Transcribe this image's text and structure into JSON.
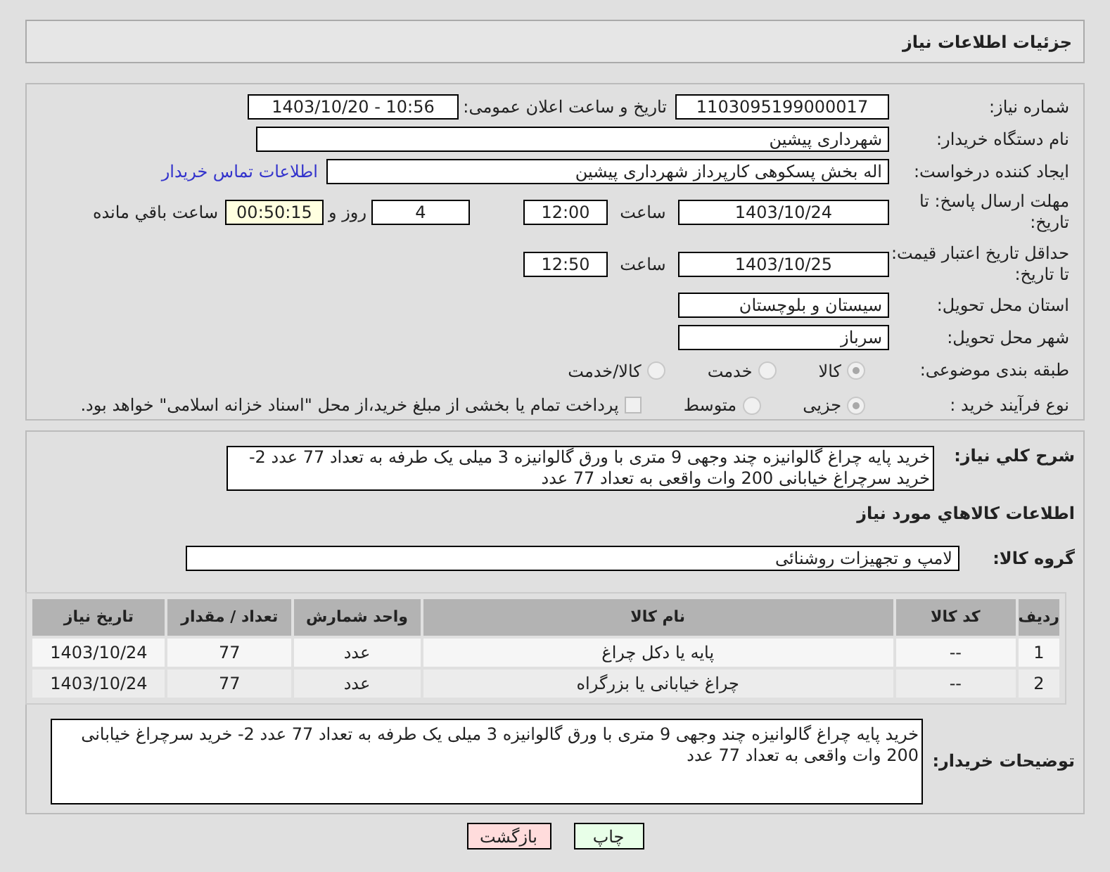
{
  "header": {
    "title": "جزئیات اطلاعات نیاز"
  },
  "details": {
    "need_number": {
      "label": "شماره نیاز:",
      "value": "1103095199000017"
    },
    "announcement": {
      "label": "تاریخ و ساعت اعلان عمومی:",
      "value": "1403/10/20 - 10:56"
    },
    "buyer_name": {
      "label": "نام دستگاه خریدار:",
      "value": "شهرداری پیشین"
    },
    "requester": {
      "label": "ایجاد کننده درخواست:",
      "value": "اله بخش پسکوهی کارپرداز شهرداری پیشین",
      "link": "اطلاعات تماس خریدار"
    },
    "deadline": {
      "label": "مهلت ارسال پاسخ: تا تاریخ:",
      "date": "1403/10/24",
      "time_label": "ساعت",
      "time": "12:00",
      "days": "4",
      "days_label": "روز و",
      "remaining": "00:50:15",
      "remaining_label": "ساعت باقي مانده"
    },
    "price_validity": {
      "label": "حداقل تاریخ اعتبار قیمت: تا تاریخ:",
      "date": "1403/10/25",
      "time_label": "ساعت",
      "time": "12:50"
    },
    "province": {
      "label": "استان محل تحویل:",
      "value": "سیستان و بلوچستان"
    },
    "city": {
      "label": "شهر محل تحویل:",
      "value": "سرباز"
    },
    "category": {
      "label": "طبقه بندی موضوعی:",
      "options": [
        {
          "label": "کالا",
          "selected": true
        },
        {
          "label": "خدمت",
          "selected": false
        },
        {
          "label": "کالا/خدمت",
          "selected": false
        }
      ]
    },
    "purchase_type": {
      "label": "نوع فرآیند خرید :",
      "options": [
        {
          "label": "جزیی",
          "selected": true
        },
        {
          "label": "متوسط",
          "selected": false
        }
      ],
      "payment": {
        "label": "پرداخت تمام یا بخشی از مبلغ خرید،از محل \"اسناد خزانه اسلامی\" خواهد بود.",
        "checked": false
      }
    }
  },
  "need_description": {
    "label": "شرح کلي نیاز:",
    "value": "خرید پایه چراغ گالوانیزه چند وجهی 9 متری با ورق گالوانیزه 3 میلی یک طرفه به تعداد 77 عدد 2- خرید سرچراغ خیابانی 200 وات واقعی به تعداد 77 عدد"
  },
  "goods_heading": "اطلاعات کالاهاي مورد نیاز",
  "goods_group": {
    "label": "گروه کالا:",
    "value": "لامپ و تجهیزات روشنائی"
  },
  "table": {
    "columns": [
      "ردیف",
      "کد کالا",
      "نام کالا",
      "واحد شمارش",
      "تعداد / مقدار",
      "تاریخ نیاز"
    ],
    "rows": [
      [
        "1",
        "--",
        "پایه یا دکل چراغ",
        "عدد",
        "77",
        "1403/10/24"
      ],
      [
        "2",
        "--",
        "چراغ خیابانی یا بزرگراه",
        "عدد",
        "77",
        "1403/10/24"
      ]
    ]
  },
  "buyer_notes": {
    "label": "توضیحات خریدار:",
    "value": "خرید پایه چراغ گالوانیزه چند وجهی 9 متری با ورق گالوانیزه 3 میلی یک طرفه به تعداد 77 عدد 2- خرید سرچراغ خیابانی 200 وات واقعی به تعداد 77 عدد"
  },
  "buttons": [
    {
      "label": "چاپ",
      "kind": "print"
    },
    {
      "label": "بازگشت",
      "kind": "back"
    }
  ]
}
